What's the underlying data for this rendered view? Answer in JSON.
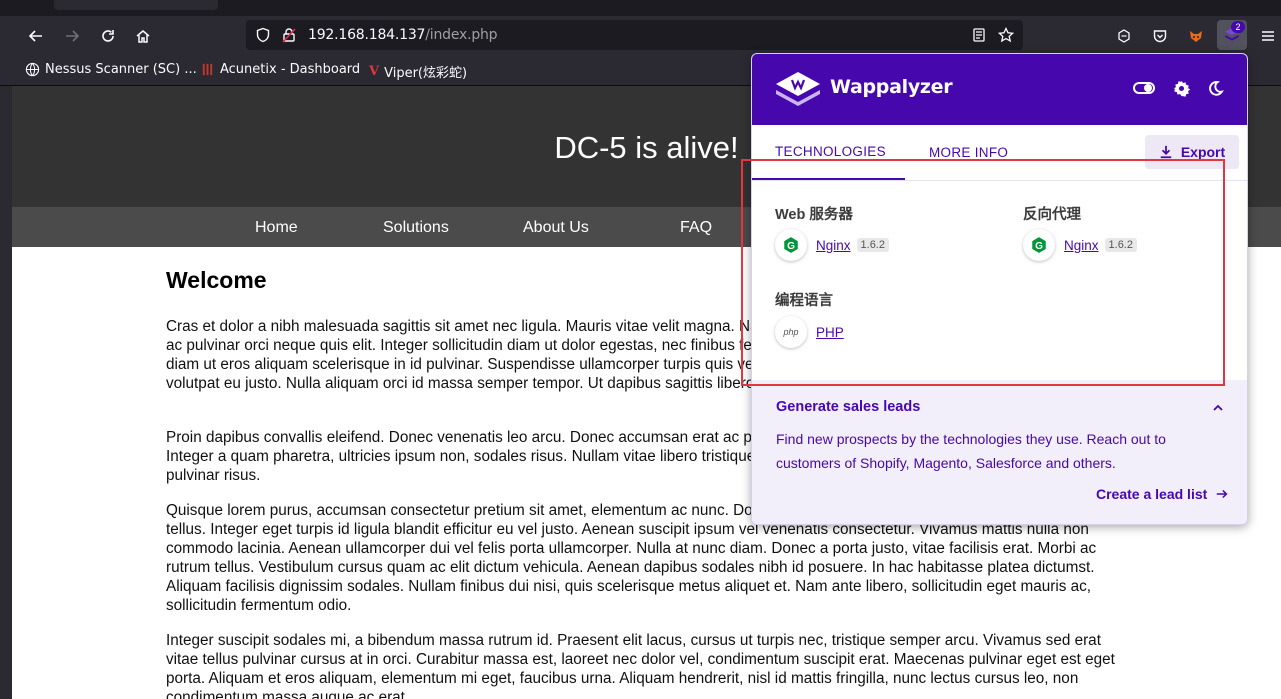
{
  "browser": {
    "url_host": "192.168.184.137",
    "url_path": "/index.php",
    "extension_badge": "2",
    "bookmarks": [
      {
        "label": "Nessus Scanner (SC) ..."
      },
      {
        "label": "Acunetix - Dashboard"
      },
      {
        "label": "Viper(炫彩蛇)"
      }
    ]
  },
  "site": {
    "title": "DC-5 is alive!",
    "nav": [
      "Home",
      "Solutions",
      "About Us",
      "FAQ"
    ],
    "heading": "Welcome",
    "paragraphs": [
      "Cras et dolor a nibh malesuada sagittis sit amet nec ligula. Mauris vitae velit magna. Nam eu pulvinar leo. Mauris vel urna malesuada diam, ac pulvinar orci neque quis elit. Integer sollicitudin diam ut dolor egestas, nec finibus felis dignissim in. Aliquam erat volutpat. Quisque a diam ut eros aliquam scelerisque in id pulvinar. Suspendisse ullamcorper turpis quis velit tempor, quis venenatis metus iaculis in. Nunc volutpat eu justo. Nulla aliquam orci id massa semper tempor. Ut dapibus sagittis libero.",
      "Proin dapibus convallis eleifend. Donec venenatis leo arcu. Donec accumsan erat ac pulvinar tempor. Aliquam lorem tempor egestas. Integer a quam pharetra, ultricies ipsum non, sodales risus. Nullam vitae libero tristique quis. Duis a leo vulputate, sollicitudin lectus vel, pulvinar risus.",
      "Quisque lorem purus, accumsan consectetur pretium sit amet, elementum ac nunc. Donec ornare condimentum et nisi. Ut quis malesuada tellus. Integer eget turpis id ligula blandit efficitur eu vel justo. Aenean suscipit ipsum vel venenatis consectetur. Vivamus mattis nulla non commodo lacinia. Aenean ullamcorper dui vel felis porta ullamcorper. Nulla at nunc diam. Donec a porta justo, vitae facilisis erat. Morbi ac rutrum tellus. Vestibulum cursus quam ac elit dictum vehicula. Aenean dapibus sodales nibh id posuere. In hac habitasse platea dictumst. Aliquam facilisis dignissim sodales. Nullam finibus dui nisi, quis scelerisque metus aliquet et. Nam ante libero, sollicitudin eget mauris ac, sollicitudin fermentum odio.",
      "Integer suscipit sodales mi, a bibendum massa rutrum id. Praesent elit lacus, cursus ut turpis nec, tristique semper arcu. Vivamus sed erat vitae tellus pulvinar cursus at in orci. Curabitur massa est, laoreet nec dolor vel, condimentum suscipit erat. Maecenas pulvinar eget est eget porta. Aliquam et eros aliquam, elementum mi eget, faucibus urna. Aliquam hendrerit, nisl id mattis fringilla, nunc lectus cursus leo, non condimentum massa augue ac erat."
    ]
  },
  "wappalyzer": {
    "brand": "Wappalyzer",
    "tabs": [
      "TECHNOLOGIES",
      "MORE INFO"
    ],
    "export_label": "Export",
    "categories": [
      {
        "name": "Web 服务器",
        "tech": "Nginx",
        "version": "1.6.2"
      },
      {
        "name": "反向代理",
        "tech": "Nginx",
        "version": "1.6.2"
      },
      {
        "name": "编程语言",
        "tech": "PHP",
        "version": ""
      }
    ],
    "leads": {
      "title": "Generate sales leads",
      "text": "Find new prospects by the technologies they use. Reach out to customers of Shopify, Magento, Salesforce and others.",
      "link": "Create a lead list"
    },
    "icon_text_php": "php"
  }
}
